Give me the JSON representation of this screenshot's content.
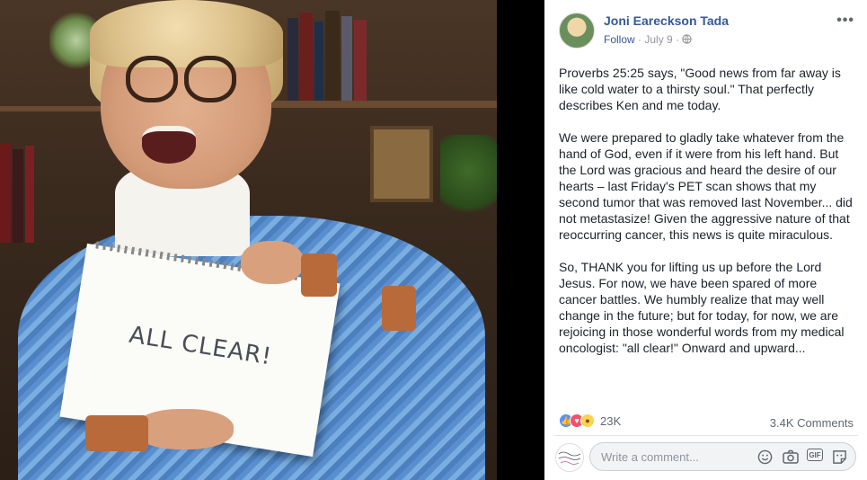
{
  "photo": {
    "notepad_text": "ALL CLEAR!"
  },
  "post": {
    "author": "Joni Eareckson Tada",
    "follow_label": "Follow",
    "separator": "·",
    "date": "July 9",
    "privacy_icon": "globe-icon",
    "more_label": "•••",
    "paragraphs": [
      "Proverbs 25:25 says, \"Good news from far away is like cold water to a thirsty soul.\" That perfectly describes Ken and me today.",
      "We were prepared to gladly take whatever from the hand of God, even if it were from his left hand. But the Lord was gracious and heard the desire of our hearts – last Friday's PET scan shows that my second tumor that was removed last November... did not metastasize! Given the aggressive nature of that reoccurring cancer, this news is quite miraculous.",
      "So, THANK you for lifting us up before the Lord Jesus. For now, we have been spared of more cancer battles. We humbly realize that may well change in the future; but for today, for now, we are rejoicing in those wonderful words from my medical oncologist: \"all clear!\" Onward and upward..."
    ],
    "reactions": {
      "icons": [
        "like-icon",
        "love-icon",
        "wow-icon"
      ],
      "count": "23K"
    },
    "comments_count": "3.4K Comments",
    "comment_box": {
      "placeholder": "Write a comment...",
      "icons": [
        "emoji-icon",
        "camera-icon",
        "gif-icon",
        "sticker-icon"
      ]
    }
  },
  "colors": {
    "link": "#365899",
    "meta": "#90949c",
    "text": "#1d2129"
  }
}
